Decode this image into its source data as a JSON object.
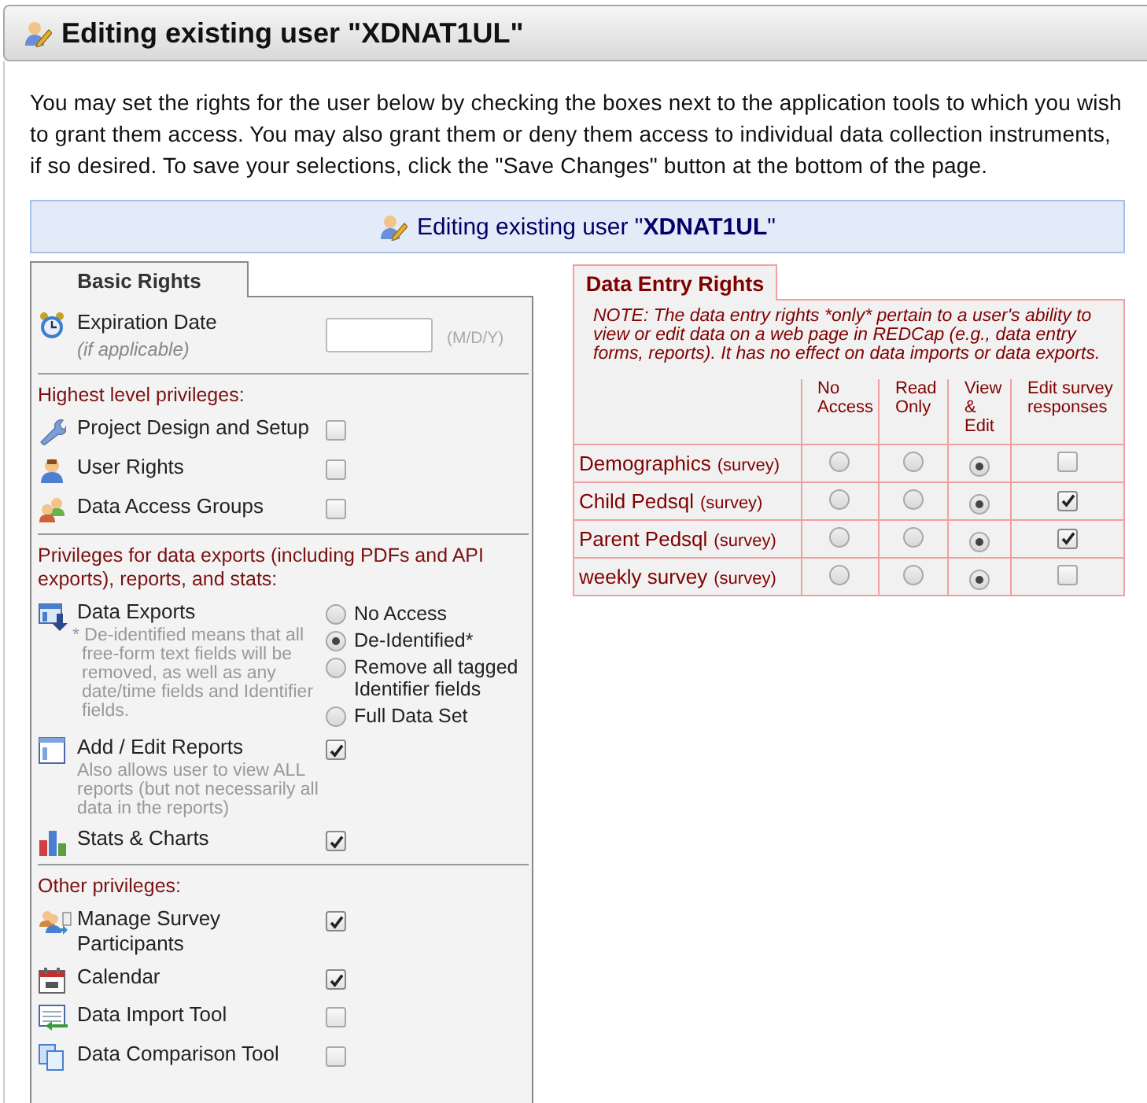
{
  "window": {
    "title": "Editing existing user \"XDNAT1UL\""
  },
  "intro": "You may set the rights for the user below by checking the boxes next to the application tools to which you wish to grant them access. You may also grant them or deny them access to individual data collection instruments, if so desired. To save your selections, click the \"Save Changes\" button at the bottom of the page.",
  "banner": "Editing existing user \"**XDNAT1UL**\"",
  "basic_rights": {
    "tab": "Basic Rights",
    "expiration": {
      "label": "Expiration Date",
      "hint": "(if applicable)",
      "format": "(M/D/Y)"
    },
    "sections": [
      {
        "heading": "Highest level privileges:",
        "items": [
          {
            "kind": "checkbox",
            "label": "Project Design and Setup",
            "checked": false
          },
          {
            "kind": "checkbox",
            "label": "User Rights",
            "checked": false
          },
          {
            "kind": "checkbox",
            "label": "Data Access Groups",
            "checked": false
          }
        ]
      },
      {
        "heading": "Privileges for data exports (including PDFs and API exports), reports, and stats:",
        "items": [
          {
            "kind": "radio_group",
            "label": "Data Exports",
            "note": "* De-identified means that all free-form text fields will be removed, as well as any date/time fields and Identifier fields.",
            "options": [
              {
                "label": "No Access",
                "selected": false
              },
              {
                "label": "De-Identified*",
                "selected": true
              },
              {
                "label": "Remove all tagged Identifier fields",
                "selected": false
              },
              {
                "label": "Full Data Set",
                "selected": false
              }
            ]
          },
          {
            "kind": "checkbox",
            "label": "Add / Edit Reports",
            "note": "Also allows user to view ALL reports (but not necessarily all data in the reports)",
            "checked": true
          },
          {
            "kind": "checkbox",
            "label": "Stats & Charts",
            "checked": true
          }
        ]
      },
      {
        "heading": "Other privileges:",
        "items": [
          {
            "kind": "checkbox",
            "label": "Manage Survey Participants",
            "checked": true
          },
          {
            "kind": "checkbox",
            "label": "Calendar",
            "checked": true
          },
          {
            "kind": "checkbox",
            "label": "Data Import Tool",
            "checked": false
          },
          {
            "kind": "checkbox",
            "label": "Data Comparison Tool",
            "checked": false
          }
        ]
      }
    ]
  },
  "data_entry_rights": {
    "tab": "Data Entry Rights",
    "note": "NOTE: The data entry rights *only* pertain to a user's ability to view or edit data on a web page in REDCap (e.g., data entry forms, reports). It has no effect on data imports or data exports.",
    "columns": [
      "No Access",
      "Read Only",
      "View & Edit",
      "Edit survey responses"
    ],
    "rows": [
      {
        "name": "Demographics",
        "tag": "(survey)",
        "access": [
          {
            "selected": false
          },
          {
            "selected": false
          },
          {
            "selected": true
          }
        ],
        "edit_survey_responses": false
      },
      {
        "name": "Child Pedsql",
        "tag": "(survey)",
        "access": [
          {
            "selected": false
          },
          {
            "selected": false
          },
          {
            "selected": true
          }
        ],
        "edit_survey_responses": true
      },
      {
        "name": "Parent Pedsql",
        "tag": "(survey)",
        "access": [
          {
            "selected": false
          },
          {
            "selected": false
          },
          {
            "selected": true
          }
        ],
        "edit_survey_responses": true
      },
      {
        "name": "weekly survey",
        "tag": "(survey)",
        "access": [
          {
            "selected": false
          },
          {
            "selected": false
          },
          {
            "selected": true
          }
        ],
        "edit_survey_responses": false
      }
    ]
  }
}
